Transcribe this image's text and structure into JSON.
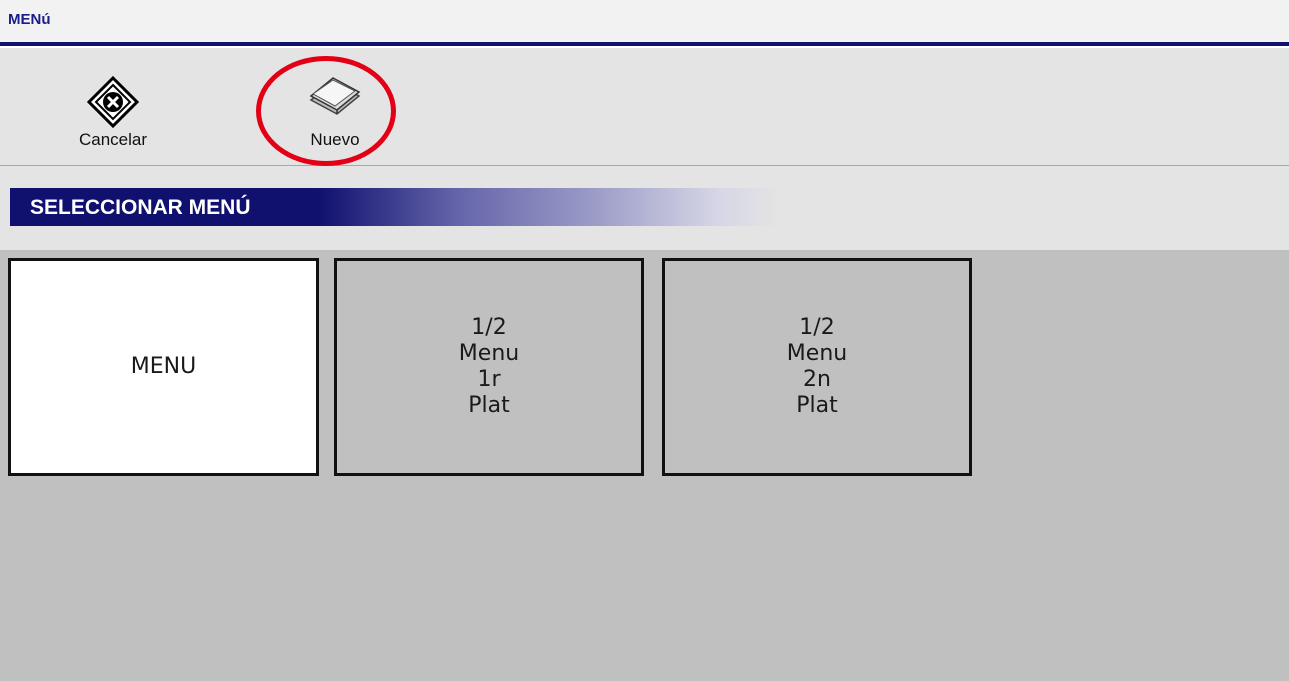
{
  "window": {
    "title": "MENú"
  },
  "toolbar": {
    "buttons": [
      {
        "label": "Cancelar",
        "icon": "cancel-x-diamond-icon"
      },
      {
        "label": "Nuevo",
        "icon": "new-paper-stack-icon"
      }
    ],
    "highlight": {
      "target": "Nuevo",
      "color": "#e30016"
    }
  },
  "section": {
    "title": "SELECCIONAR MENÚ",
    "accent": "#10106e"
  },
  "tiles": [
    {
      "lines": [
        "MENU"
      ],
      "selected": true
    },
    {
      "lines": [
        "1/2",
        "Menu",
        "1r",
        "Plat"
      ],
      "selected": false
    },
    {
      "lines": [
        "1/2",
        "Menu",
        "2n",
        "Plat"
      ],
      "selected": false
    }
  ]
}
